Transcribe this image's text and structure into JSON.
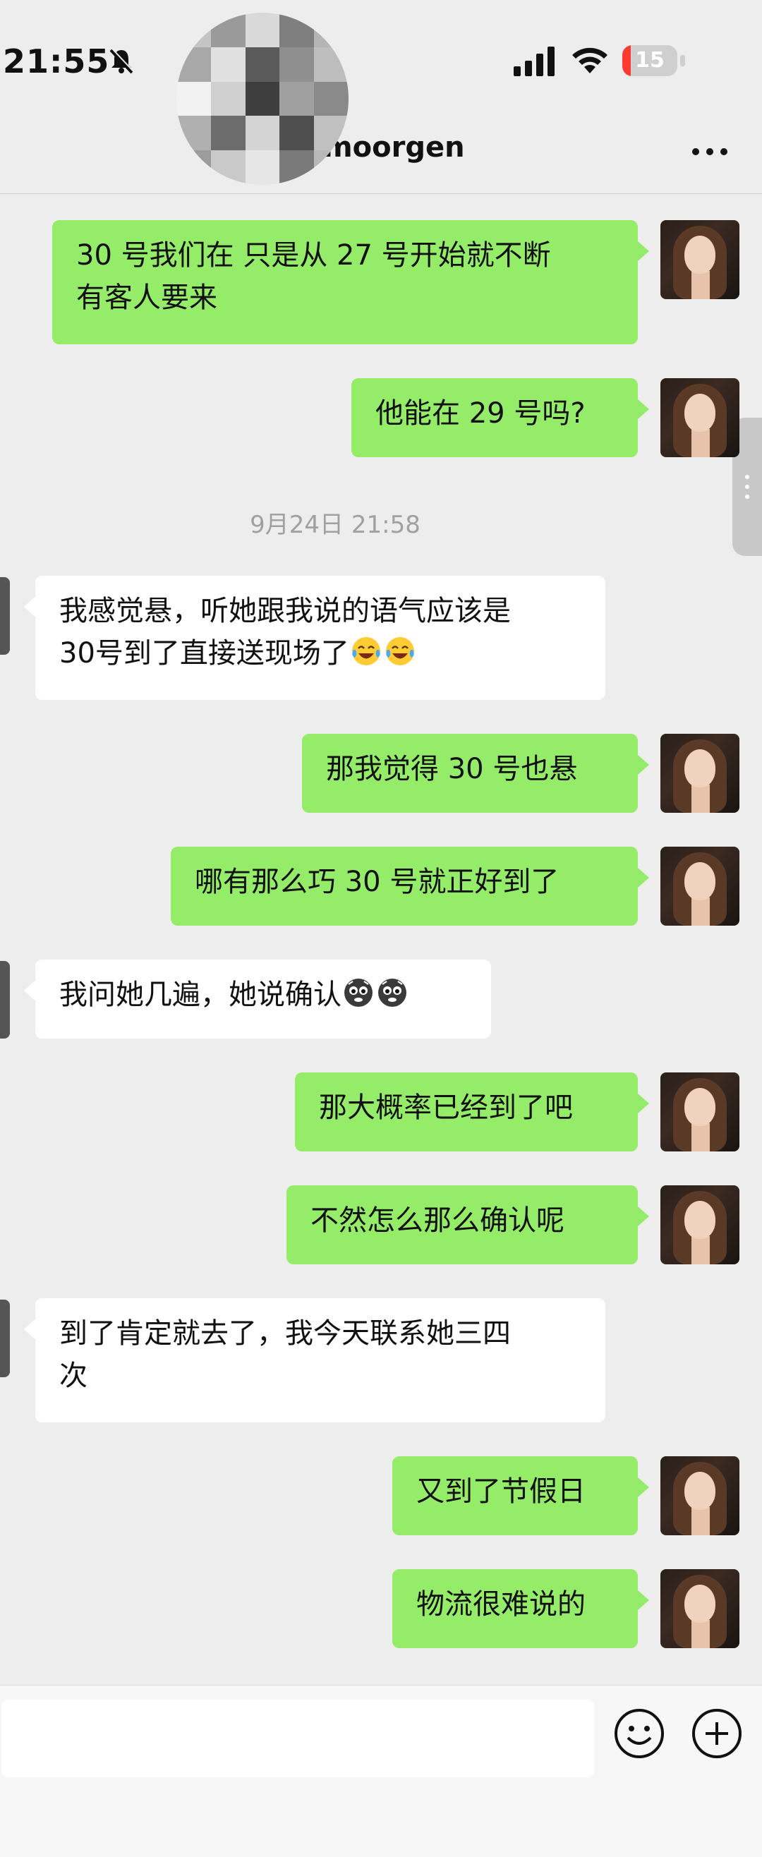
{
  "status_bar": {
    "time": "21:55",
    "battery_level": "15",
    "battery_fraction": 0.15,
    "battery_color": "#ff3b30"
  },
  "header": {
    "title": "moorgen",
    "more_icon": "more-icon"
  },
  "colors": {
    "outgoing_bubble": "#95ec69",
    "incoming_bubble": "#ffffff",
    "background": "#ededed"
  },
  "messages": [
    {
      "direction": "out",
      "text_lines": [
        "30 号我们在 只是从 27 号开始就不断",
        "有客人要来"
      ]
    },
    {
      "direction": "out",
      "text_lines": [
        "他能在 29 号吗?"
      ]
    },
    {
      "direction": "in",
      "text_lines": [
        "我感觉悬，听她跟我说的语气应该是",
        "30号到了直接送现场了"
      ],
      "emoji": "tears-of-joy-emoji"
    },
    {
      "direction": "out",
      "text_lines": [
        "那我觉得 30 号也悬"
      ]
    },
    {
      "direction": "out",
      "text_lines": [
        "哪有那么巧 30 号就正好到了"
      ]
    },
    {
      "direction": "in",
      "text_lines": [
        "我问她几遍，她说确认"
      ],
      "emoji": "crying-face-emoji"
    },
    {
      "direction": "out",
      "text_lines": [
        "那大概率已经到了吧"
      ]
    },
    {
      "direction": "out",
      "text_lines": [
        "不然怎么那么确认呢"
      ]
    },
    {
      "direction": "in",
      "text_lines": [
        "到了肯定就去了，我今天联系她三四",
        "次"
      ]
    },
    {
      "direction": "out",
      "text_lines": [
        "又到了节假日"
      ]
    },
    {
      "direction": "out",
      "text_lines": [
        "物流很难说的"
      ]
    }
  ],
  "timestamp": "9月24日 21:58",
  "input": {
    "value": "",
    "emoji_icon": "emoji-icon",
    "plus_icon": "plus-icon"
  }
}
